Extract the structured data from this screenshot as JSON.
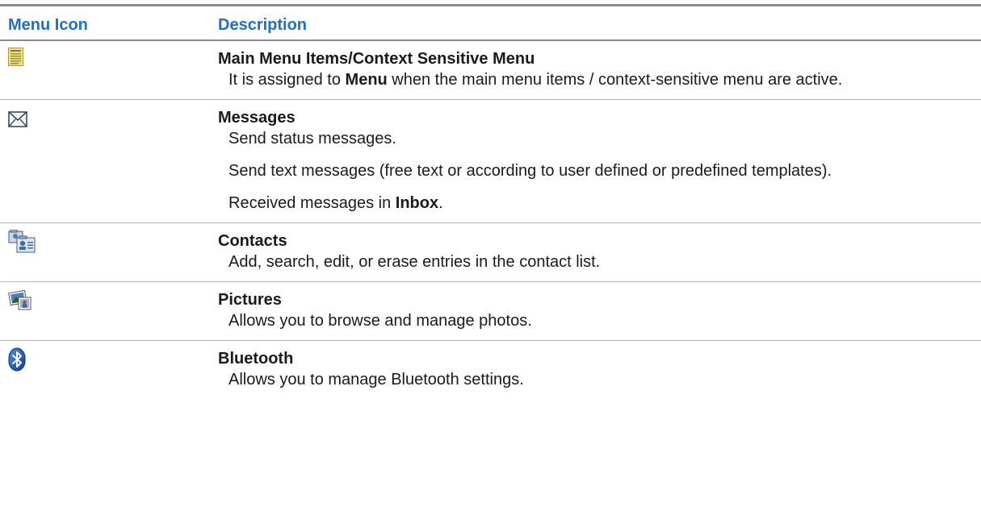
{
  "table": {
    "header_icon": "Menu Icon",
    "header_description": "Description"
  },
  "rows": [
    {
      "icon": "menu-list-icon",
      "title": "Main Menu Items/Context Sensitive Menu",
      "para1": {
        "a": "It is assigned to ",
        "b": "Menu",
        "c": " when the main menu items / context-sensitive menu are active."
      }
    },
    {
      "icon": "envelope-icon",
      "title": "Messages",
      "para1": "Send status messages.",
      "para2": "Send text messages (free text or according to user defined or predefined templates).",
      "para3": {
        "a": "Received messages in ",
        "b": "Inbox",
        "c": "."
      }
    },
    {
      "icon": "contacts-icon",
      "title": "Contacts",
      "para1": "Add, search, edit, or erase entries in the contact list."
    },
    {
      "icon": "pictures-icon",
      "title": "Pictures",
      "para1": "Allows you to browse and manage photos."
    },
    {
      "icon": "bluetooth-icon",
      "title": "Bluetooth",
      "para1": "Allows you to manage Bluetooth settings."
    }
  ],
  "colors": {
    "header_text": "#1f6fc5",
    "rule": "#8c8c8c"
  }
}
